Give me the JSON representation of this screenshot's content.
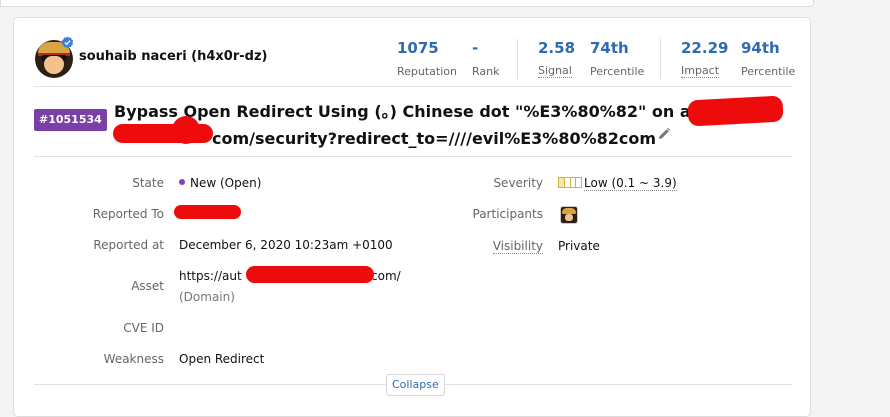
{
  "reporter": {
    "name": "souhaib naceri (h4x0r-dz)"
  },
  "stats": {
    "reputation": {
      "value": "1075",
      "label": "Reputation"
    },
    "rank": {
      "value": "-",
      "label": "Rank"
    },
    "signal": {
      "value": "2.58",
      "label": "Signal"
    },
    "signal_percentile": {
      "value": "74th",
      "label": "Percentile"
    },
    "impact": {
      "value": "22.29",
      "label": "Impact"
    },
    "impact_percentile": {
      "value": "94th",
      "label": "Percentile"
    }
  },
  "report": {
    "id": "#1051534",
    "title_line1": "Bypass Open Redirect Using (。) Chinese dot \"%E3%80%82\" on auth",
    "title_line2": "com/security?redirect_to=////evil%E3%80%82com"
  },
  "details": {
    "state": {
      "label": "State",
      "value": "New (Open)"
    },
    "reported_to": {
      "label": "Reported To",
      "value": ""
    },
    "reported_at": {
      "label": "Reported at",
      "value": "December 6, 2020 10:23am +0100"
    },
    "asset": {
      "label": "Asset",
      "value_prefix": "https://aut",
      "value_suffix": "com/",
      "type": "(Domain)"
    },
    "cve_id": {
      "label": "CVE ID",
      "value": ""
    },
    "weakness": {
      "label": "Weakness",
      "value": "Open Redirect"
    },
    "severity": {
      "label": "Severity",
      "value": "Low (0.1 ~ 3.9)",
      "level": 0.25
    },
    "participants": {
      "label": "Participants"
    },
    "visibility": {
      "label": "Visibility",
      "value": "Private"
    }
  },
  "actions": {
    "collapse": "Collapse"
  },
  "colors": {
    "accent": "#2e6bb0",
    "report_id_badge": "#7b3fa8",
    "redaction": "#ee0b0b",
    "severity_low": "#d6b23c"
  },
  "icons": [
    "avatar",
    "verified-badge-icon",
    "pencil-icon",
    "state-dot-icon",
    "severity-meter-icon",
    "participant-avatar"
  ]
}
